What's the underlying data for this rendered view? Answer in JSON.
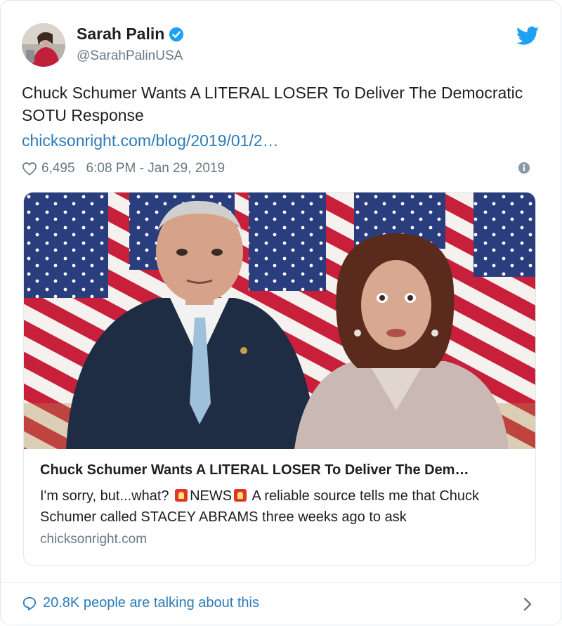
{
  "tweet": {
    "display_name": "Sarah Palin",
    "handle": "@SarahPalinUSA",
    "text": "Chuck Schumer Wants A LITERAL LOSER To Deliver The Democratic SOTU Response",
    "link": "chicksonright.com/blog/2019/01/2…",
    "likes": "6,495",
    "timestamp": "6:08 PM - Jan 29, 2019"
  },
  "card": {
    "title": "Chuck Schumer Wants A LITERAL LOSER To Deliver The Dem…",
    "desc_part1": "I'm sorry, but...what?",
    "desc_news": "NEWS",
    "desc_part2": "A reliable source tells me that Chuck Schumer called STACEY ABRAMS three weeks ago to ask",
    "domain": "chicksonright.com"
  },
  "footer": {
    "talking": "20.8K people are talking about this"
  },
  "icons": {
    "verified": "verified-badge-icon",
    "twitter": "twitter-bird-icon",
    "like": "heart-icon",
    "info": "info-icon",
    "siren": "police-siren-icon",
    "reply": "speech-bubble-icon",
    "chevron": "chevron-right-icon"
  },
  "colors": {
    "link": "#2b7bb9",
    "muted": "#697882",
    "text": "#1c2022",
    "twitter_blue": "#1da1f2"
  }
}
